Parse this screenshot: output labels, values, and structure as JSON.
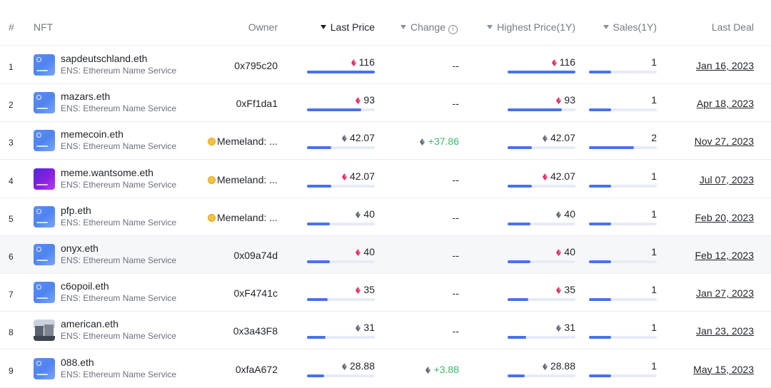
{
  "header": {
    "index": "#",
    "nft": "NFT",
    "owner": "Owner",
    "last_price": "Last Price",
    "change": "Change",
    "highest_price": "Highest Price(1Y)",
    "sales": "Sales(1Y)",
    "last_deal": "Last Deal"
  },
  "colors": {
    "accent": "#4a72e8",
    "bar_track": "#e6ebf6",
    "positive": "#3cb56b",
    "eth_red": "#e8245d",
    "eth_gray": "#5f6570",
    "owner_badge": "#f5c242"
  },
  "rows": [
    {
      "index": "1",
      "name": "sapdeutschland.eth",
      "collection": "ENS: Ethereum Name Service",
      "thumb": "ens-blue",
      "owner": "0x795c20",
      "owner_icon": false,
      "last_price": "116",
      "last_price_eth": "red",
      "last_price_level": 1.0,
      "change": "--",
      "change_positive": false,
      "highest_price": "116",
      "highest_price_eth": "red",
      "highest_price_level": 1.0,
      "sales": "1",
      "sales_level": 0.33,
      "last_deal": "Jan 16, 2023"
    },
    {
      "index": "2",
      "name": "mazars.eth",
      "collection": "ENS: Ethereum Name Service",
      "thumb": "ens-blue",
      "owner": "0xFf1da1",
      "owner_icon": false,
      "last_price": "93",
      "last_price_eth": "red",
      "last_price_level": 0.8,
      "change": "--",
      "change_positive": false,
      "highest_price": "93",
      "highest_price_eth": "red",
      "highest_price_level": 0.8,
      "sales": "1",
      "sales_level": 0.33,
      "last_deal": "Apr 18, 2023"
    },
    {
      "index": "3",
      "name": "memecoin.eth",
      "collection": "ENS: Ethereum Name Service",
      "thumb": "ens-blue",
      "owner": "Memeland: ...",
      "owner_icon": true,
      "last_price": "42.07",
      "last_price_eth": "gray",
      "last_price_level": 0.36,
      "change": "+37.86",
      "change_positive": true,
      "highest_price": "42.07",
      "highest_price_eth": "gray",
      "highest_price_level": 0.36,
      "sales": "2",
      "sales_level": 0.66,
      "last_deal": "Nov 27, 2023"
    },
    {
      "index": "4",
      "name": "meme.wantsome.eth",
      "collection": "ENS: Ethereum Name Service",
      "thumb": "ens-purple",
      "owner": "Memeland: ...",
      "owner_icon": true,
      "last_price": "42.07",
      "last_price_eth": "red",
      "last_price_level": 0.36,
      "change": "--",
      "change_positive": false,
      "highest_price": "42.07",
      "highest_price_eth": "red",
      "highest_price_level": 0.36,
      "sales": "1",
      "sales_level": 0.33,
      "last_deal": "Jul 07, 2023"
    },
    {
      "index": "5",
      "name": "pfp.eth",
      "collection": "ENS: Ethereum Name Service",
      "thumb": "ens-blue",
      "owner": "Memeland: ...",
      "owner_icon": true,
      "last_price": "40",
      "last_price_eth": "gray",
      "last_price_level": 0.34,
      "change": "--",
      "change_positive": false,
      "highest_price": "40",
      "highest_price_eth": "gray",
      "highest_price_level": 0.34,
      "sales": "1",
      "sales_level": 0.33,
      "last_deal": "Feb 20, 2023"
    },
    {
      "index": "6",
      "name": "onyx.eth",
      "collection": "ENS: Ethereum Name Service",
      "thumb": "ens-blue",
      "owner": "0x09a74d",
      "owner_icon": false,
      "last_price": "40",
      "last_price_eth": "red",
      "last_price_level": 0.34,
      "change": "--",
      "change_positive": false,
      "highest_price": "40",
      "highest_price_eth": "red",
      "highest_price_level": 0.34,
      "sales": "1",
      "sales_level": 0.33,
      "last_deal": "Feb 12, 2023"
    },
    {
      "index": "7",
      "name": "c6opoil.eth",
      "collection": "ENS: Ethereum Name Service",
      "thumb": "ens-blue",
      "owner": "0xF4741c",
      "owner_icon": false,
      "last_price": "35",
      "last_price_eth": "red",
      "last_price_level": 0.3,
      "change": "--",
      "change_positive": false,
      "highest_price": "35",
      "highest_price_eth": "red",
      "highest_price_level": 0.3,
      "sales": "1",
      "sales_level": 0.33,
      "last_deal": "Jan 27, 2023"
    },
    {
      "index": "8",
      "name": "american.eth",
      "collection": "ENS: Ethereum Name Service",
      "thumb": "photo",
      "owner": "0x3a43F8",
      "owner_icon": false,
      "last_price": "31",
      "last_price_eth": "gray",
      "last_price_level": 0.27,
      "change": "--",
      "change_positive": false,
      "highest_price": "31",
      "highest_price_eth": "gray",
      "highest_price_level": 0.27,
      "sales": "1",
      "sales_level": 0.33,
      "last_deal": "Jan 23, 2023"
    },
    {
      "index": "9",
      "name": "088.eth",
      "collection": "ENS: Ethereum Name Service",
      "thumb": "ens-blue",
      "owner": "0xfaA672",
      "owner_icon": false,
      "last_price": "28.88",
      "last_price_eth": "gray",
      "last_price_level": 0.25,
      "change": "+3.88",
      "change_positive": true,
      "highest_price": "28.88",
      "highest_price_eth": "gray",
      "highest_price_level": 0.25,
      "sales": "1",
      "sales_level": 0.33,
      "last_deal": "May 15, 2023"
    }
  ]
}
